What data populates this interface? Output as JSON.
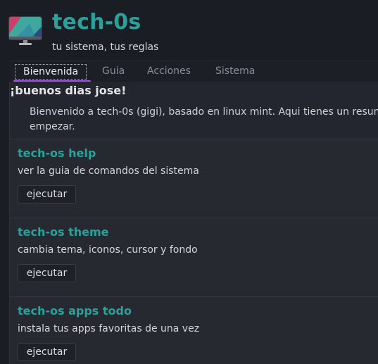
{
  "header": {
    "title": "tech-0s",
    "subtitle": "tu sistema, tus reglas",
    "logo_icon": "monitor-logo-icon"
  },
  "tabs": [
    {
      "label": "Bienvenida",
      "active": true
    },
    {
      "label": "Guia",
      "active": false
    },
    {
      "label": "Acciones",
      "active": false
    },
    {
      "label": "Sistema",
      "active": false
    }
  ],
  "welcome": {
    "greeting": "¡buenos dias jose!",
    "intro_line1": "Bienvenido a tech-0s (gigi), basado en linux mint. Aqui tienes un resum",
    "intro_line2": "empezar."
  },
  "cards": [
    {
      "title": "tech-os help",
      "description": "ver la guia de comandos del sistema",
      "button": "ejecutar"
    },
    {
      "title": "tech-os theme",
      "description": "cambia tema, iconos, cursor y fondo",
      "button": "ejecutar"
    },
    {
      "title": "tech-os apps todo",
      "description": "instala tus apps favoritas de una vez",
      "button": "ejecutar"
    }
  ],
  "colors": {
    "accent": "#2aa19a",
    "tab_indicator": "#a64dfc",
    "background": "#1b1d24"
  }
}
